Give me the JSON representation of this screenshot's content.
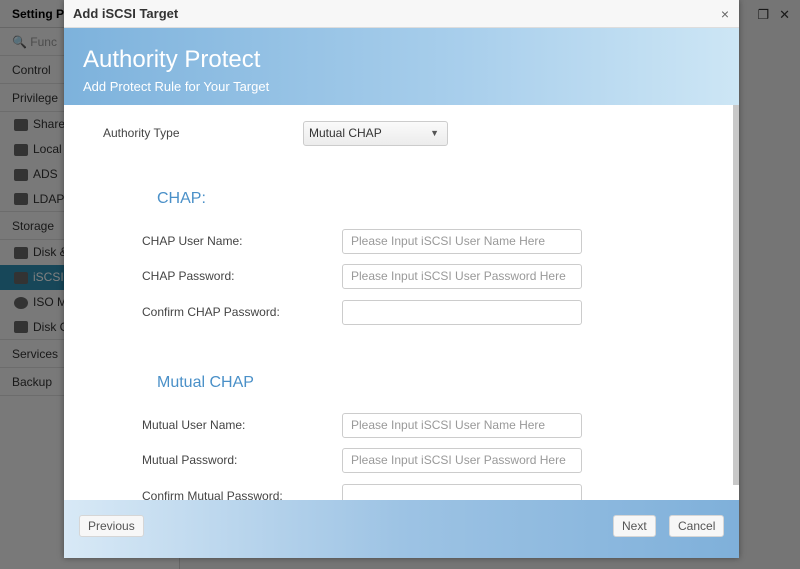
{
  "background": {
    "title": "Setting P",
    "search_placeholder": "Func",
    "sections": [
      "Control",
      "Privilege"
    ],
    "privilege_items": [
      "Share",
      "Local",
      "ADS",
      "LDAP"
    ],
    "storage": "Storage",
    "storage_items": [
      "Disk &",
      "iSCSI",
      "ISO M",
      "Disk C"
    ],
    "services": "Services",
    "backup": "Backup"
  },
  "dialog": {
    "title": "Add iSCSI Target",
    "close": "×",
    "header": {
      "title": "Authority Protect",
      "subtitle": "Add Protect Rule for Your Target"
    },
    "authority_type": {
      "label": "Authority Type",
      "value": "Mutual CHAP"
    },
    "chap": {
      "heading": "CHAP:",
      "user_label": "CHAP User Name:",
      "user_placeholder": "Please Input iSCSI User Name Here",
      "pass_label": "CHAP Password:",
      "pass_placeholder": "Please Input iSCSI User Password Here",
      "confirm_label": "Confirm CHAP Password:"
    },
    "mutual": {
      "heading": "Mutual CHAP",
      "user_label": "Mutual User Name:",
      "user_placeholder": "Please Input iSCSI User Name Here",
      "pass_label": "Mutual Password:",
      "pass_placeholder": "Please Input iSCSI User Password Here",
      "confirm_label": "Confirm Mutual Password:"
    },
    "buttons": {
      "previous": "Previous",
      "next": "Next",
      "cancel": "Cancel"
    }
  }
}
